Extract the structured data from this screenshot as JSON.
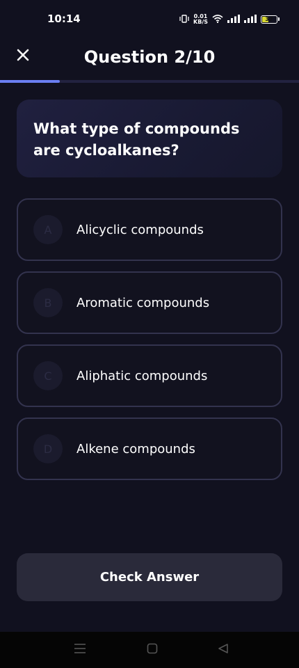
{
  "status_bar": {
    "time": "10:14",
    "net_speed_value": "0.01",
    "net_speed_unit": "KB/S",
    "battery_level": "37"
  },
  "header": {
    "title": "Question 2/10"
  },
  "progress": {
    "current": 2,
    "total": 10
  },
  "question": {
    "text": "What type of compounds are cycloalkanes?"
  },
  "options": [
    {
      "letter": "A",
      "label": "Alicyclic compounds"
    },
    {
      "letter": "B",
      "label": "Aromatic compounds"
    },
    {
      "letter": "C",
      "label": "Aliphatic compounds"
    },
    {
      "letter": "D",
      "label": "Alkene compounds"
    }
  ],
  "actions": {
    "check_label": "Check Answer"
  },
  "colors": {
    "background": "#11111f",
    "accent": "#6b7ff2",
    "card": "#1c1c38",
    "option_border": "#33334e",
    "button": "#2a2a3a"
  },
  "icons": {
    "close": "close-icon",
    "menu": "menu-icon",
    "home": "home-icon",
    "back": "back-icon"
  }
}
